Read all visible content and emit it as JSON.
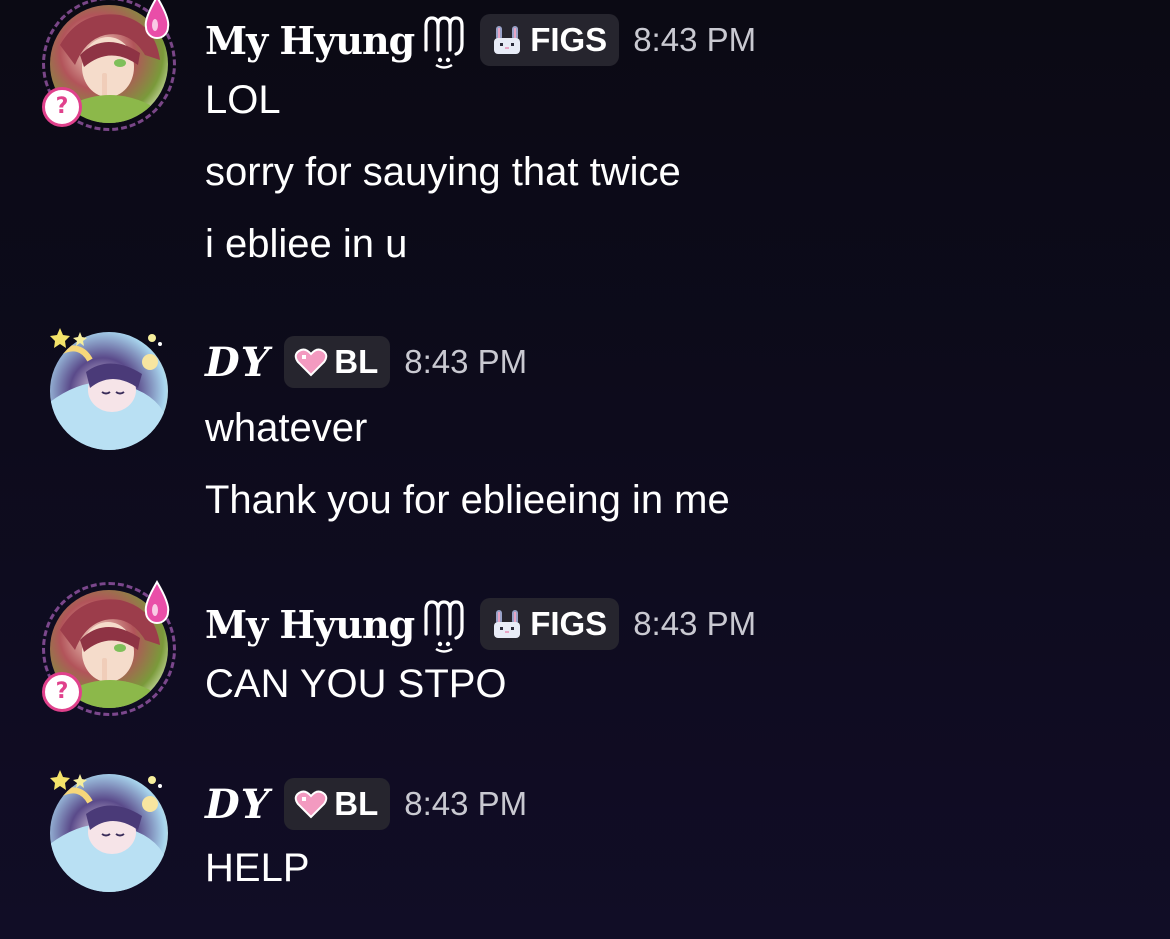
{
  "messages": [
    {
      "author": "My Hyung",
      "tag": "FIGS",
      "time": "8:43 PM",
      "lines": [
        "LOL",
        "sorry for sauying that twice",
        "i ebliee in u"
      ]
    },
    {
      "author": "DY",
      "tag": "BL",
      "time": "8:43 PM",
      "lines": [
        "whatever",
        "Thank you for eblieeing in me"
      ]
    },
    {
      "author": "My Hyung",
      "tag": "FIGS",
      "time": "8:43 PM",
      "lines": [
        "CAN YOU STPO"
      ]
    },
    {
      "author": "DY",
      "tag": "BL",
      "time": "8:43 PM",
      "lines": [
        "HELP"
      ]
    }
  ],
  "icons": {
    "my_hyung_avatar": "anime-avatar-red-hair",
    "dy_avatar": "anime-avatar-sleeping",
    "zodiac": "virgo-icon",
    "figs_tag": "bunny-icon",
    "bl_tag": "heart-icon",
    "status": "question-status-icon"
  },
  "colors": {
    "background": "#0d0b1c",
    "tag_bg": "#26252e",
    "timestamp": "#c9c9d1",
    "status_pink": "#e0418c"
  }
}
